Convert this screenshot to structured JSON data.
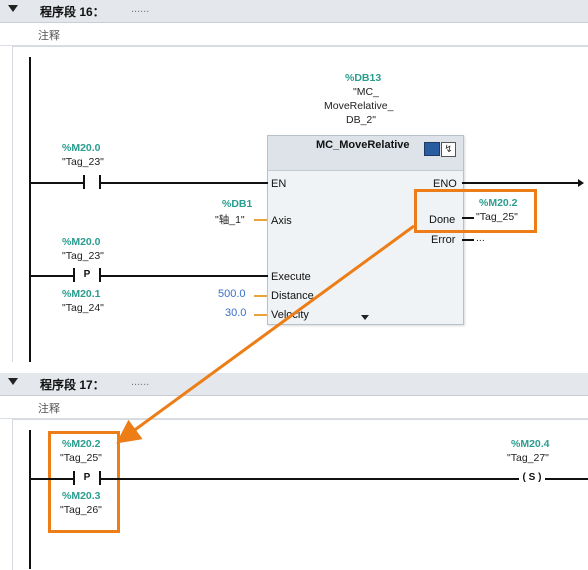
{
  "segment16": {
    "title": "程序段 16：",
    "dots": "......",
    "comment": "注释",
    "db": {
      "addr": "%DB13",
      "name_l1": "\"MC_",
      "name_l2": "MoveRelative_",
      "name_l3": "DB_2\""
    },
    "block": {
      "name": "MC_MoveRelative",
      "icon_left": "monitor-icon",
      "icon_right": "help-icon"
    },
    "en_contact": {
      "addr": "%M20.0",
      "tag": "\"Tag_23\""
    },
    "axis": {
      "addr": "%DB1",
      "tag": "\"轴_1\""
    },
    "execute_contact": {
      "addr": "%M20.0",
      "tag": "\"Tag_23\"",
      "type": "P",
      "edge_addr": "%M20.1",
      "edge_tag": "\"Tag_24\""
    },
    "distance_value": "500.0",
    "velocity_value": "30.0",
    "pins": {
      "en": "EN",
      "eno": "ENO",
      "axis": "Axis",
      "done": "Done",
      "error": "Error",
      "execute": "Execute",
      "distance": "Distance",
      "velocity": "Velocity"
    },
    "done_output": {
      "addr": "%M20.2",
      "tag": "\"Tag_25\""
    },
    "error_output": "..."
  },
  "segment17": {
    "title": "程序段 17：",
    "dots": "......",
    "comment": "注释",
    "contact": {
      "addr": "%M20.2",
      "tag": "\"Tag_25\"",
      "type": "P",
      "edge_addr": "%M20.3",
      "edge_tag": "\"Tag_26\""
    },
    "coil": {
      "addr": "%M20.4",
      "tag": "\"Tag_27\"",
      "type": "( S )"
    }
  },
  "colors": {
    "highlight": "#ed7d16",
    "address": "#2a9d8f",
    "value": "#3a6fc6"
  }
}
